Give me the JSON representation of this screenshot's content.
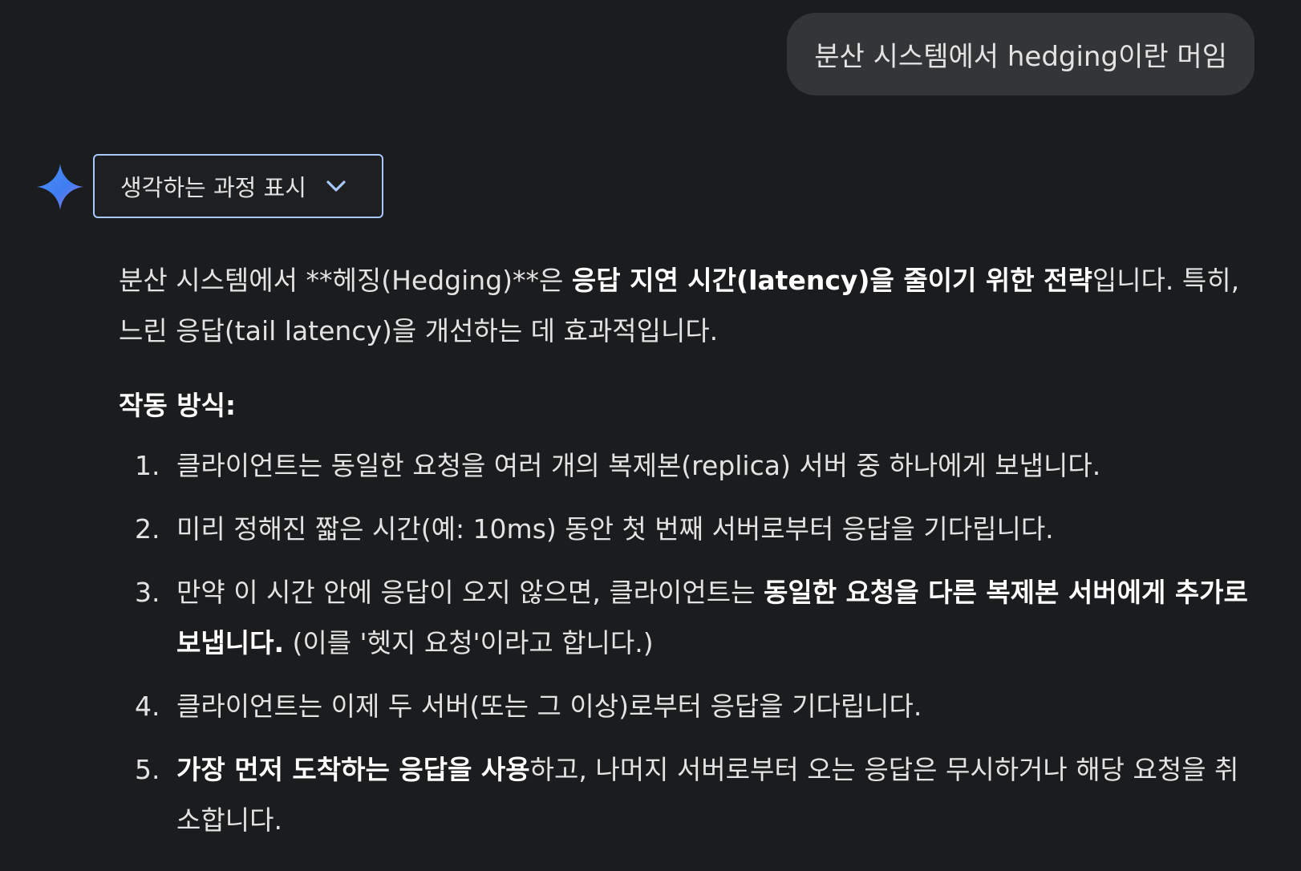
{
  "user_message": "분산 시스템에서 hedging이란 머임",
  "assistant": {
    "icon": "gemini-sparkle-icon",
    "thinking_toggle_label": "생각하는 과정 표시",
    "intro": {
      "p1": "분산 시스템에서 **헤징(Hedging)**은 ",
      "b1": "응답 지연 시간(latency)을 줄이기 위한 전략",
      "p2": "입니다. 특히, 느린 응답(tail latency)을 개선하는 데 효과적입니다."
    },
    "heading": "작동 방식:",
    "steps": [
      {
        "num": "1.",
        "pre": "클라이언트는 동일한 요청을 여러 개의 복제본(replica) 서버 중 하나에게 보냅니다.",
        "bold": "",
        "post": ""
      },
      {
        "num": "2.",
        "pre": "미리 정해진 짧은 시간(예: 10ms) 동안 첫 번째 서버로부터 응답을 기다립니다.",
        "bold": "",
        "post": ""
      },
      {
        "num": "3.",
        "pre": "만약 이 시간 안에 응답이 오지 않으면, 클라이언트는 ",
        "bold": "동일한 요청을 다른 복제본 서버에게 추가로 보냅니다.",
        "post": " (이를 '헷지 요청'이라고 합니다.)"
      },
      {
        "num": "4.",
        "pre": "클라이언트는 이제 두 서버(또는 그 이상)로부터 응답을 기다립니다.",
        "bold": "",
        "post": ""
      },
      {
        "num": "5.",
        "pre": "",
        "bold": "가장 먼저 도착하는 응답을 사용",
        "post": "하고, 나머지 서버로부터 오는 응답은 무시하거나 해당 요청을 취소합니다."
      }
    ]
  },
  "colors": {
    "background": "#1b1c1d",
    "user_bubble": "#333537",
    "toggle_border": "#a8c7fa",
    "text": "#e3e3e3"
  }
}
